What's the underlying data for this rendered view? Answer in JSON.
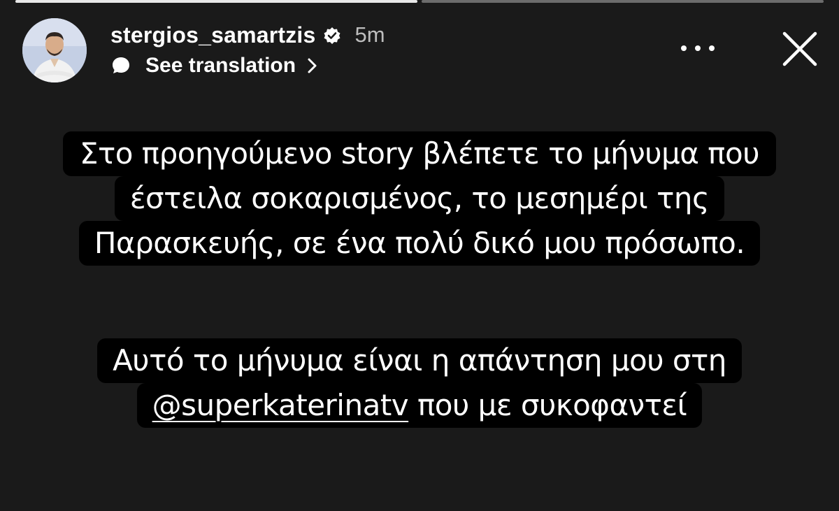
{
  "progress": {
    "segments": [
      {
        "state": "viewed",
        "fill": 1.0
      },
      {
        "state": "current",
        "fill": 0.0
      }
    ]
  },
  "header": {
    "username": "stergios_samartzis",
    "verified": true,
    "time_ago": "5m",
    "translation_label": "See translation",
    "icons": {
      "verified": "verified-badge-icon",
      "translate": "speech-bubble-icon",
      "chevron": "chevron-right-icon",
      "more": "more-horizontal-icon",
      "close": "close-icon"
    }
  },
  "story_text": {
    "block1": [
      "Στο προηγούμενο story βλέπετε το μήνυμα που",
      "έστειλα σοκαρισμένος, το μεσημέρι της",
      "Παρασκευής, σε ένα πολύ δικό μου πρόσωπο."
    ],
    "block2": {
      "line1": "Αυτό το μήνυμα είναι η απάντηση μου στη",
      "mention": "@superkaterinatv",
      "line2_rest": " που με συκοφαντεί"
    }
  },
  "colors": {
    "background": "#1a1a1a",
    "text_box": "#000000",
    "text": "#ffffff",
    "secondary_text": "#bdbdbd"
  }
}
